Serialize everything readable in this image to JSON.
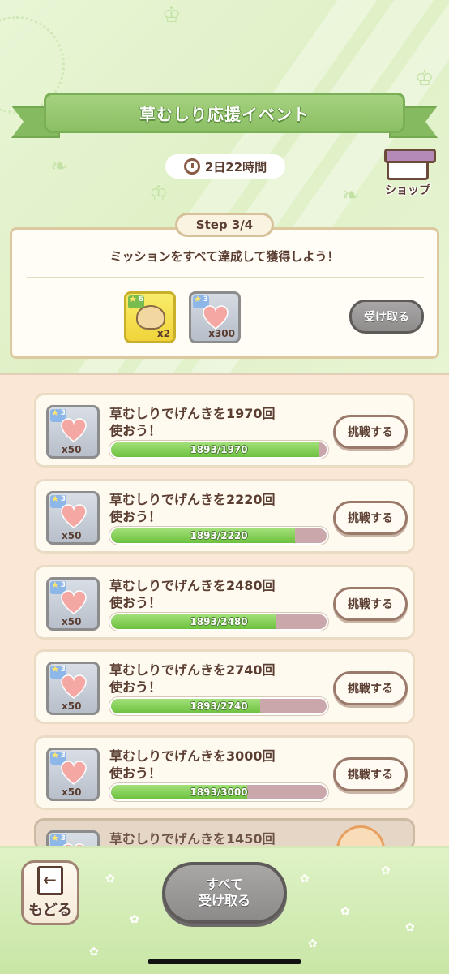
{
  "header": {
    "title": "草むしり応援イベント",
    "timer": "2日22時間",
    "shop_label": "ショップ"
  },
  "step": {
    "label": "Step 3/4",
    "mission_text": "ミッションをすべて達成して獲得しよう！",
    "rewards": [
      {
        "rank": "6",
        "qty": "x2",
        "icon": "shell-icon"
      },
      {
        "rank": "3",
        "qty": "x300",
        "icon": "heart-icon"
      }
    ],
    "receive_label": "受け取る"
  },
  "missions": [
    {
      "rank": "3",
      "qty": "x50",
      "title_line1": "草むしりでげんきを1970回",
      "title_line2": "使おう！",
      "progress_text": "1893/1970",
      "progress": 0.961,
      "button": "挑戦する"
    },
    {
      "rank": "3",
      "qty": "x50",
      "title_line1": "草むしりでげんきを2220回",
      "title_line2": "使おう！",
      "progress_text": "1893/2220",
      "progress": 0.853,
      "button": "挑戦する"
    },
    {
      "rank": "3",
      "qty": "x50",
      "title_line1": "草むしりでげんきを2480回",
      "title_line2": "使おう！",
      "progress_text": "1893/2480",
      "progress": 0.763,
      "button": "挑戦する"
    },
    {
      "rank": "3",
      "qty": "x50",
      "title_line1": "草むしりでげんきを2740回",
      "title_line2": "使おう！",
      "progress_text": "1893/2740",
      "progress": 0.691,
      "button": "挑戦する"
    },
    {
      "rank": "3",
      "qty": "x50",
      "title_line1": "草むしりでげんきを3000回",
      "title_line2": "使おう！",
      "progress_text": "1893/3000",
      "progress": 0.631,
      "button": "挑戦する"
    },
    {
      "rank": "3",
      "title_line1": "草むしりでげんきを1450回"
    }
  ],
  "footer": {
    "back_label": "もどる",
    "receive_all_line1": "すべて",
    "receive_all_line2": "受け取る"
  },
  "colors": {
    "accent_green": "#8cc065",
    "progress_green": "#6cc13e",
    "progress_empty": "#c9a7aa",
    "heart_pink": "#f4a7a3"
  }
}
